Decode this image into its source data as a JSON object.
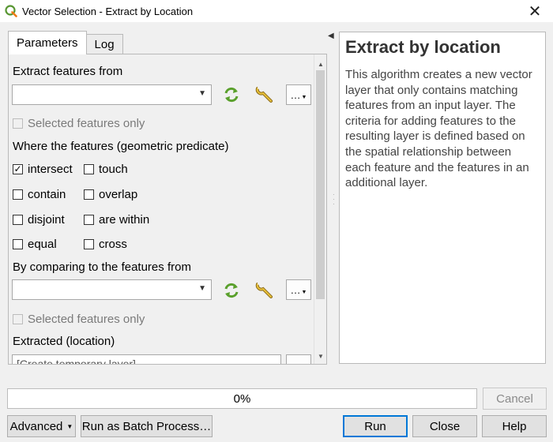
{
  "window": {
    "title": "Vector Selection - Extract by Location",
    "close_glyph": "✕"
  },
  "tabs": [
    {
      "label": "Parameters",
      "active": true
    },
    {
      "label": "Log",
      "active": false
    }
  ],
  "form": {
    "extract_from_label": "Extract features from",
    "extract_from_value": "",
    "selected_only_1": "Selected features only",
    "predicate_label": "Where the features (geometric predicate)",
    "predicates": [
      {
        "label": "intersect",
        "checked": true
      },
      {
        "label": "touch",
        "checked": false
      },
      {
        "label": "contain",
        "checked": false
      },
      {
        "label": "overlap",
        "checked": false
      },
      {
        "label": "disjoint",
        "checked": false
      },
      {
        "label": "are within",
        "checked": false
      },
      {
        "label": "equal",
        "checked": false
      },
      {
        "label": "cross",
        "checked": false
      }
    ],
    "compare_label": "By comparing to the features from",
    "compare_value": "",
    "selected_only_2": "Selected features only",
    "output_label": "Extracted (location)",
    "output_value": "[Create temporary layer]",
    "dots_label": "…",
    "check_glyph": "✓"
  },
  "help": {
    "title": "Extract by location",
    "body": "This algorithm creates a new vector layer that only contains matching features from an input layer. The criteria for adding features to the resulting layer is defined based on the spatial relationship between each feature and the features in an additional layer."
  },
  "progress": {
    "value": 0,
    "text": "0%"
  },
  "buttons": {
    "cancel": "Cancel",
    "advanced": "Advanced",
    "batch": "Run as Batch Process…",
    "run": "Run",
    "close": "Close",
    "help": "Help"
  },
  "colors": {
    "accent": "#0078d7",
    "iterate_icon": "#5aa02c"
  },
  "icons": [
    "qgis-icon",
    "close-icon",
    "iterate-icon",
    "wrench-icon",
    "dropdown-arrow-icon",
    "chevron-left-icon"
  ]
}
